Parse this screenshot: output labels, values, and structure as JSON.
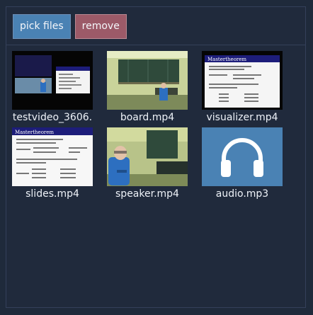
{
  "toolbar": {
    "pick_label": "pick files",
    "remove_label": "remove"
  },
  "files": [
    {
      "name": "testvideo_3606.",
      "icon": "video-thumbnail"
    },
    {
      "name": "board.mp4",
      "icon": "video-thumbnail"
    },
    {
      "name": "visualizer.mp4",
      "icon": "video-thumbnail"
    },
    {
      "name": "slides.mp4",
      "icon": "video-thumbnail"
    },
    {
      "name": "speaker.mp4",
      "icon": "video-thumbnail"
    },
    {
      "name": "audio.mp3",
      "icon": "headphones-icon"
    }
  ],
  "thumbs": {
    "slide_title": "Mastertheorem"
  },
  "colors": {
    "accent": "#4a82b4",
    "danger": "#9c5a68",
    "bg": "#202a3c"
  }
}
